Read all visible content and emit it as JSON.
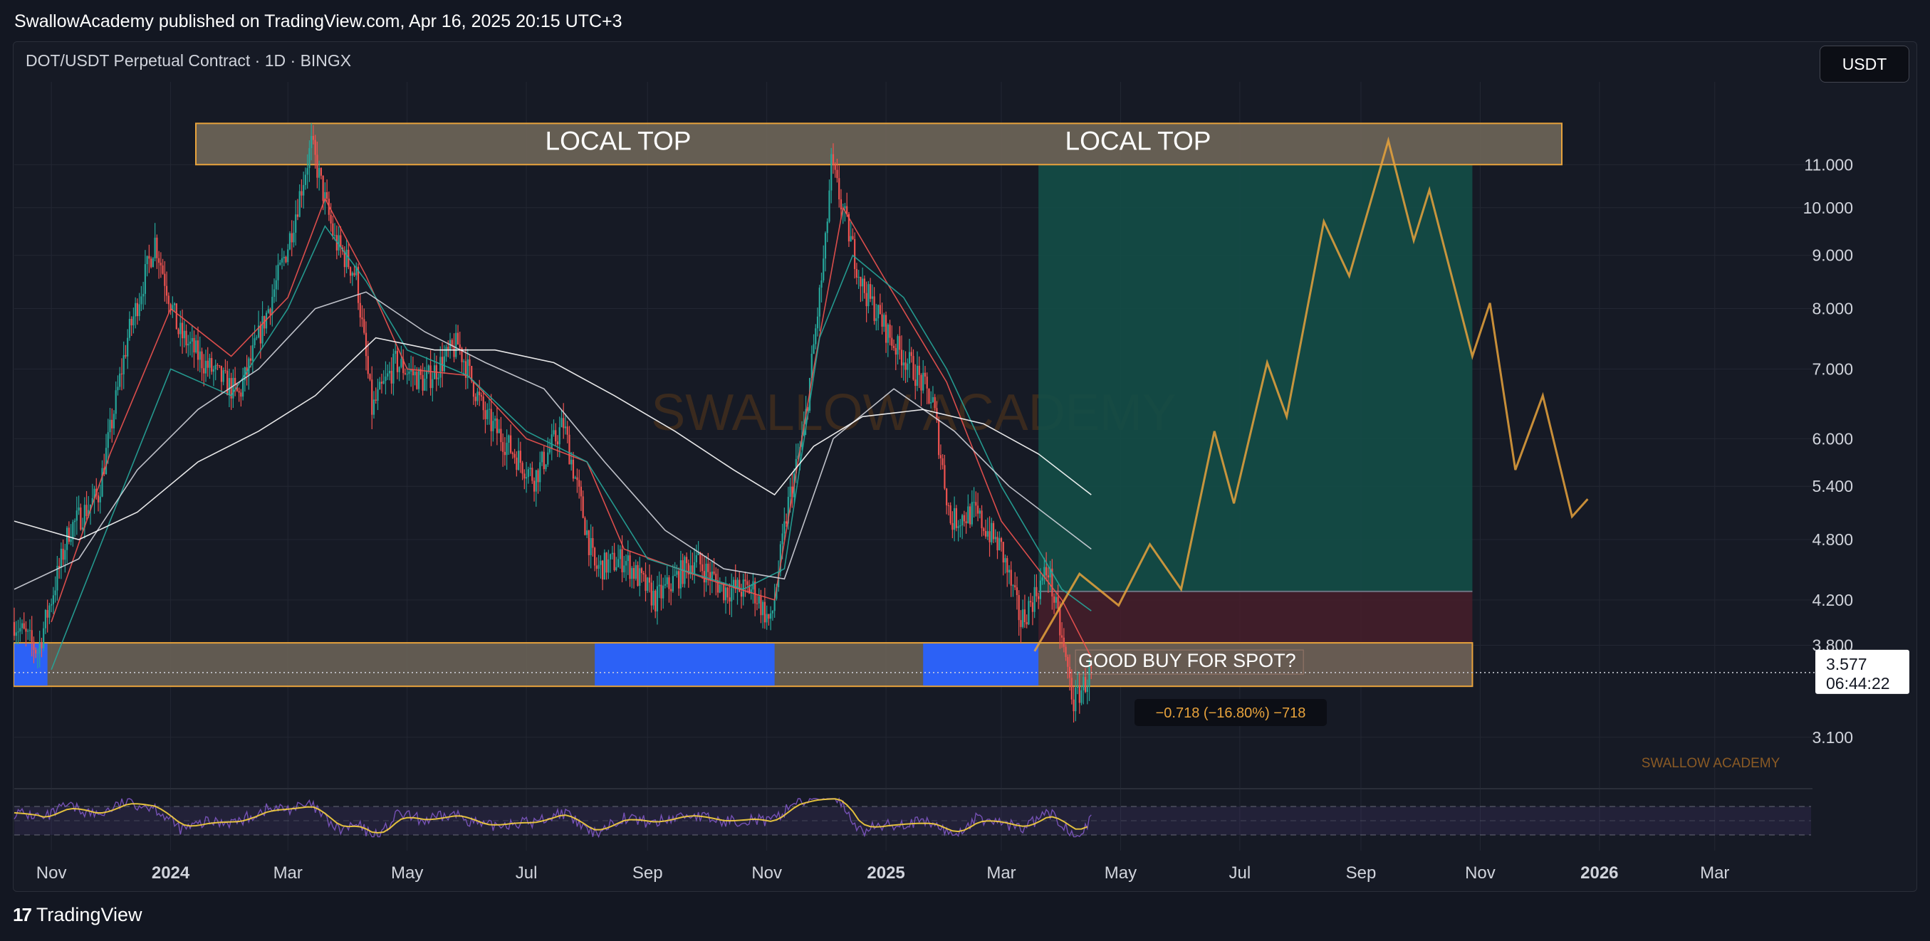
{
  "header": {
    "publish_line": "SwallowAcademy published on TradingView.com, Apr 16, 2025 20:15 UTC+3"
  },
  "symbol_line": "DOT/USDT Perpetual Contract · 1D · BINGX",
  "currency_button": "USDT",
  "footer": {
    "logo_glyph": "17",
    "brand": "TradingView"
  },
  "watermark": "SWALLOW ACADEMY",
  "watermark_small": "SWALLOW ACADEMY",
  "price_label": {
    "price": "3.577",
    "countdown": "06:44:22"
  },
  "measure_label": "−0.718 (−16.80%) −718",
  "colors": {
    "bull": "#26a69a",
    "bear": "#ef5350",
    "orange": "#e8a33c",
    "blue": "#2962ff",
    "green_zone": "#134e47",
    "red_zone": "#4a1e2b",
    "rsi": "#7e57c2",
    "rsi_ma": "#f7d23e"
  },
  "chart_data": {
    "type": "candlestick",
    "title": "DOT/USDT Perpetual Contract · 1D · BINGX",
    "scale": "log",
    "ylim": [
      2.78,
      12.6
    ],
    "xlim": [
      "2023-10-13",
      "2026-04-20"
    ],
    "y_ticks": [
      "11.000",
      "10.000",
      "9.000",
      "8.000",
      "7.000",
      "6.000",
      "5.400",
      "4.800",
      "4.200",
      "3.800",
      "3.100"
    ],
    "y_tick_values": [
      11,
      10,
      9,
      8,
      7,
      6,
      5.4,
      4.8,
      4.2,
      3.8,
      3.1
    ],
    "x_ticks": [
      {
        "label": "Nov",
        "date": "2023-11-01",
        "bold": false
      },
      {
        "label": "2024",
        "date": "2024-01-01",
        "bold": true
      },
      {
        "label": "Mar",
        "date": "2024-03-01",
        "bold": false
      },
      {
        "label": "May",
        "date": "2024-05-01",
        "bold": false
      },
      {
        "label": "Jul",
        "date": "2024-07-01",
        "bold": false
      },
      {
        "label": "Sep",
        "date": "2024-09-01",
        "bold": false
      },
      {
        "label": "Nov",
        "date": "2024-11-01",
        "bold": false
      },
      {
        "label": "2025",
        "date": "2025-01-01",
        "bold": true
      },
      {
        "label": "Mar",
        "date": "2025-03-01",
        "bold": false
      },
      {
        "label": "May",
        "date": "2025-05-01",
        "bold": false
      },
      {
        "label": "Jul",
        "date": "2025-07-01",
        "bold": false
      },
      {
        "label": "Sep",
        "date": "2025-09-01",
        "bold": false
      },
      {
        "label": "Nov",
        "date": "2025-11-01",
        "bold": false
      },
      {
        "label": "2026",
        "date": "2026-01-01",
        "bold": true
      },
      {
        "label": "Mar",
        "date": "2026-03-01",
        "bold": false
      }
    ],
    "price_path": [
      [
        "2023-10-13",
        4.0
      ],
      [
        "2023-10-25",
        3.75
      ],
      [
        "2023-11-10",
        4.9
      ],
      [
        "2023-11-25",
        5.3
      ],
      [
        "2023-12-10",
        7.5
      ],
      [
        "2023-12-24",
        9.3
      ],
      [
        "2024-01-05",
        7.6
      ],
      [
        "2024-01-18",
        7.1
      ],
      [
        "2024-02-05",
        6.6
      ],
      [
        "2024-02-20",
        8.0
      ],
      [
        "2024-03-01",
        9.2
      ],
      [
        "2024-03-13",
        11.5
      ],
      [
        "2024-03-25",
        9.3
      ],
      [
        "2024-04-05",
        8.6
      ],
      [
        "2024-04-13",
        6.4
      ],
      [
        "2024-04-25",
        7.1
      ],
      [
        "2024-05-10",
        6.8
      ],
      [
        "2024-05-27",
        7.4
      ],
      [
        "2024-06-10",
        6.3
      ],
      [
        "2024-06-25",
        5.8
      ],
      [
        "2024-07-05",
        5.5
      ],
      [
        "2024-07-20",
        6.2
      ],
      [
        "2024-08-05",
        4.5
      ],
      [
        "2024-08-20",
        4.6
      ],
      [
        "2024-09-05",
        4.2
      ],
      [
        "2024-09-25",
        4.6
      ],
      [
        "2024-10-10",
        4.3
      ],
      [
        "2024-10-25",
        4.3
      ],
      [
        "2024-11-03",
        3.98
      ],
      [
        "2024-11-12",
        5.2
      ],
      [
        "2024-11-20",
        6.1
      ],
      [
        "2024-12-01",
        9.2
      ],
      [
        "2024-12-04",
        11.0
      ],
      [
        "2024-12-12",
        9.6
      ],
      [
        "2024-12-20",
        8.4
      ],
      [
        "2025-01-05",
        7.4
      ],
      [
        "2025-01-15",
        7.0
      ],
      [
        "2025-01-25",
        6.5
      ],
      [
        "2025-02-03",
        5.0
      ],
      [
        "2025-02-15",
        5.1
      ],
      [
        "2025-03-01",
        4.7
      ],
      [
        "2025-03-11",
        4.0
      ],
      [
        "2025-03-25",
        4.5
      ],
      [
        "2025-04-07",
        3.35
      ],
      [
        "2025-04-16",
        3.58
      ]
    ],
    "moving_averages": [
      {
        "color": "#ef5350",
        "points": [
          [
            "2023-11-01",
            4.0
          ],
          [
            "2023-12-01",
            5.8
          ],
          [
            "2024-01-01",
            8.0
          ],
          [
            "2024-02-01",
            7.2
          ],
          [
            "2024-03-01",
            8.2
          ],
          [
            "2024-03-20",
            10.2
          ],
          [
            "2024-04-10",
            8.6
          ],
          [
            "2024-05-01",
            7.0
          ],
          [
            "2024-06-01",
            6.9
          ],
          [
            "2024-07-01",
            6.0
          ],
          [
            "2024-08-01",
            5.7
          ],
          [
            "2024-08-20",
            4.7
          ],
          [
            "2024-10-01",
            4.4
          ],
          [
            "2024-11-05",
            4.2
          ],
          [
            "2024-11-25",
            7.0
          ],
          [
            "2024-12-10",
            10.0
          ],
          [
            "2025-01-01",
            8.5
          ],
          [
            "2025-02-01",
            6.8
          ],
          [
            "2025-03-01",
            5.0
          ],
          [
            "2025-04-01",
            4.2
          ],
          [
            "2025-04-16",
            3.7
          ]
        ]
      },
      {
        "color": "#26a69a",
        "points": [
          [
            "2023-11-01",
            3.6
          ],
          [
            "2023-12-01",
            5.0
          ],
          [
            "2024-01-01",
            7.0
          ],
          [
            "2024-02-01",
            6.6
          ],
          [
            "2024-03-01",
            8.0
          ],
          [
            "2024-03-20",
            9.6
          ],
          [
            "2024-04-10",
            8.5
          ],
          [
            "2024-05-01",
            7.3
          ],
          [
            "2024-06-01",
            6.9
          ],
          [
            "2024-07-01",
            6.1
          ],
          [
            "2024-08-01",
            5.7
          ],
          [
            "2024-09-01",
            4.6
          ],
          [
            "2024-10-20",
            4.3
          ],
          [
            "2024-11-10",
            4.5
          ],
          [
            "2024-11-28",
            7.5
          ],
          [
            "2024-12-15",
            9.0
          ],
          [
            "2025-01-10",
            8.2
          ],
          [
            "2025-02-01",
            7.0
          ],
          [
            "2025-03-01",
            5.4
          ],
          [
            "2025-04-01",
            4.3
          ],
          [
            "2025-04-16",
            4.1
          ]
        ]
      },
      {
        "color": "#d1d4dc",
        "points": [
          [
            "2023-10-13",
            4.3
          ],
          [
            "2023-11-15",
            4.6
          ],
          [
            "2023-12-15",
            5.6
          ],
          [
            "2024-01-15",
            6.4
          ],
          [
            "2024-02-15",
            7.0
          ],
          [
            "2024-03-15",
            8.0
          ],
          [
            "2024-04-10",
            8.3
          ],
          [
            "2024-05-10",
            7.6
          ],
          [
            "2024-06-10",
            7.1
          ],
          [
            "2024-07-10",
            6.7
          ],
          [
            "2024-08-10",
            5.7
          ],
          [
            "2024-09-10",
            4.9
          ],
          [
            "2024-10-10",
            4.5
          ],
          [
            "2024-11-10",
            4.4
          ],
          [
            "2024-12-05",
            6.0
          ],
          [
            "2025-01-05",
            6.7
          ],
          [
            "2025-02-05",
            6.1
          ],
          [
            "2025-03-05",
            5.4
          ],
          [
            "2025-04-16",
            4.7
          ]
        ]
      },
      {
        "color": "#ffffff",
        "points": [
          [
            "2023-10-13",
            5.0
          ],
          [
            "2023-11-15",
            4.8
          ],
          [
            "2023-12-15",
            5.1
          ],
          [
            "2024-01-15",
            5.7
          ],
          [
            "2024-02-15",
            6.1
          ],
          [
            "2024-03-15",
            6.6
          ],
          [
            "2024-04-15",
            7.5
          ],
          [
            "2024-05-15",
            7.3
          ],
          [
            "2024-06-15",
            7.3
          ],
          [
            "2024-07-15",
            7.1
          ],
          [
            "2024-08-15",
            6.6
          ],
          [
            "2024-09-15",
            6.1
          ],
          [
            "2024-10-15",
            5.6
          ],
          [
            "2024-11-05",
            5.3
          ],
          [
            "2024-11-25",
            5.9
          ],
          [
            "2024-12-20",
            6.3
          ],
          [
            "2025-01-20",
            6.4
          ],
          [
            "2025-02-20",
            6.2
          ],
          [
            "2025-03-20",
            5.8
          ],
          [
            "2025-04-16",
            5.3
          ]
        ]
      }
    ],
    "projection_path": [
      [
        "2025-03-18",
        3.75
      ],
      [
        "2025-04-10",
        4.45
      ],
      [
        "2025-04-30",
        4.15
      ],
      [
        "2025-05-16",
        4.75
      ],
      [
        "2025-06-01",
        4.3
      ],
      [
        "2025-06-18",
        6.1
      ],
      [
        "2025-06-28",
        5.2
      ],
      [
        "2025-07-15",
        7.1
      ],
      [
        "2025-07-25",
        6.3
      ],
      [
        "2025-08-13",
        9.7
      ],
      [
        "2025-08-26",
        8.6
      ],
      [
        "2025-09-15",
        11.6
      ],
      [
        "2025-09-28",
        9.3
      ],
      [
        "2025-10-06",
        10.4
      ],
      [
        "2025-10-28",
        7.2
      ],
      [
        "2025-11-06",
        8.1
      ],
      [
        "2025-11-19",
        5.6
      ],
      [
        "2025-12-03",
        6.6
      ],
      [
        "2025-12-18",
        5.05
      ],
      [
        "2025-12-26",
        5.25
      ]
    ],
    "zones": [
      {
        "label": "LOCAL TOP",
        "type": "resistance",
        "from": "2024-01-01",
        "to": "2025-12-18",
        "y": [
          11.0,
          12.05
        ]
      },
      {
        "label": "GOOD BUY FOR SPOT?",
        "type": "support",
        "from": "2023-10-13",
        "to": "2025-10-28",
        "y": [
          3.47,
          3.82
        ]
      }
    ],
    "zone_labels": [
      "LOCAL TOP",
      "LOCAL TOP",
      "GOOD BUY FOR SPOT?"
    ],
    "position": {
      "from": "2025-03-20",
      "to": "2025-10-28",
      "entry": 4.28,
      "target": 11.0,
      "stop": 3.47
    },
    "last_price": 3.577,
    "measurement": {
      "change": -0.718,
      "percent": -16.8,
      "ticks": -718
    },
    "rsi_panel": {
      "series": [
        "RSI",
        "RSI-based MA"
      ],
      "levels": [
        70,
        50,
        30
      ]
    }
  }
}
